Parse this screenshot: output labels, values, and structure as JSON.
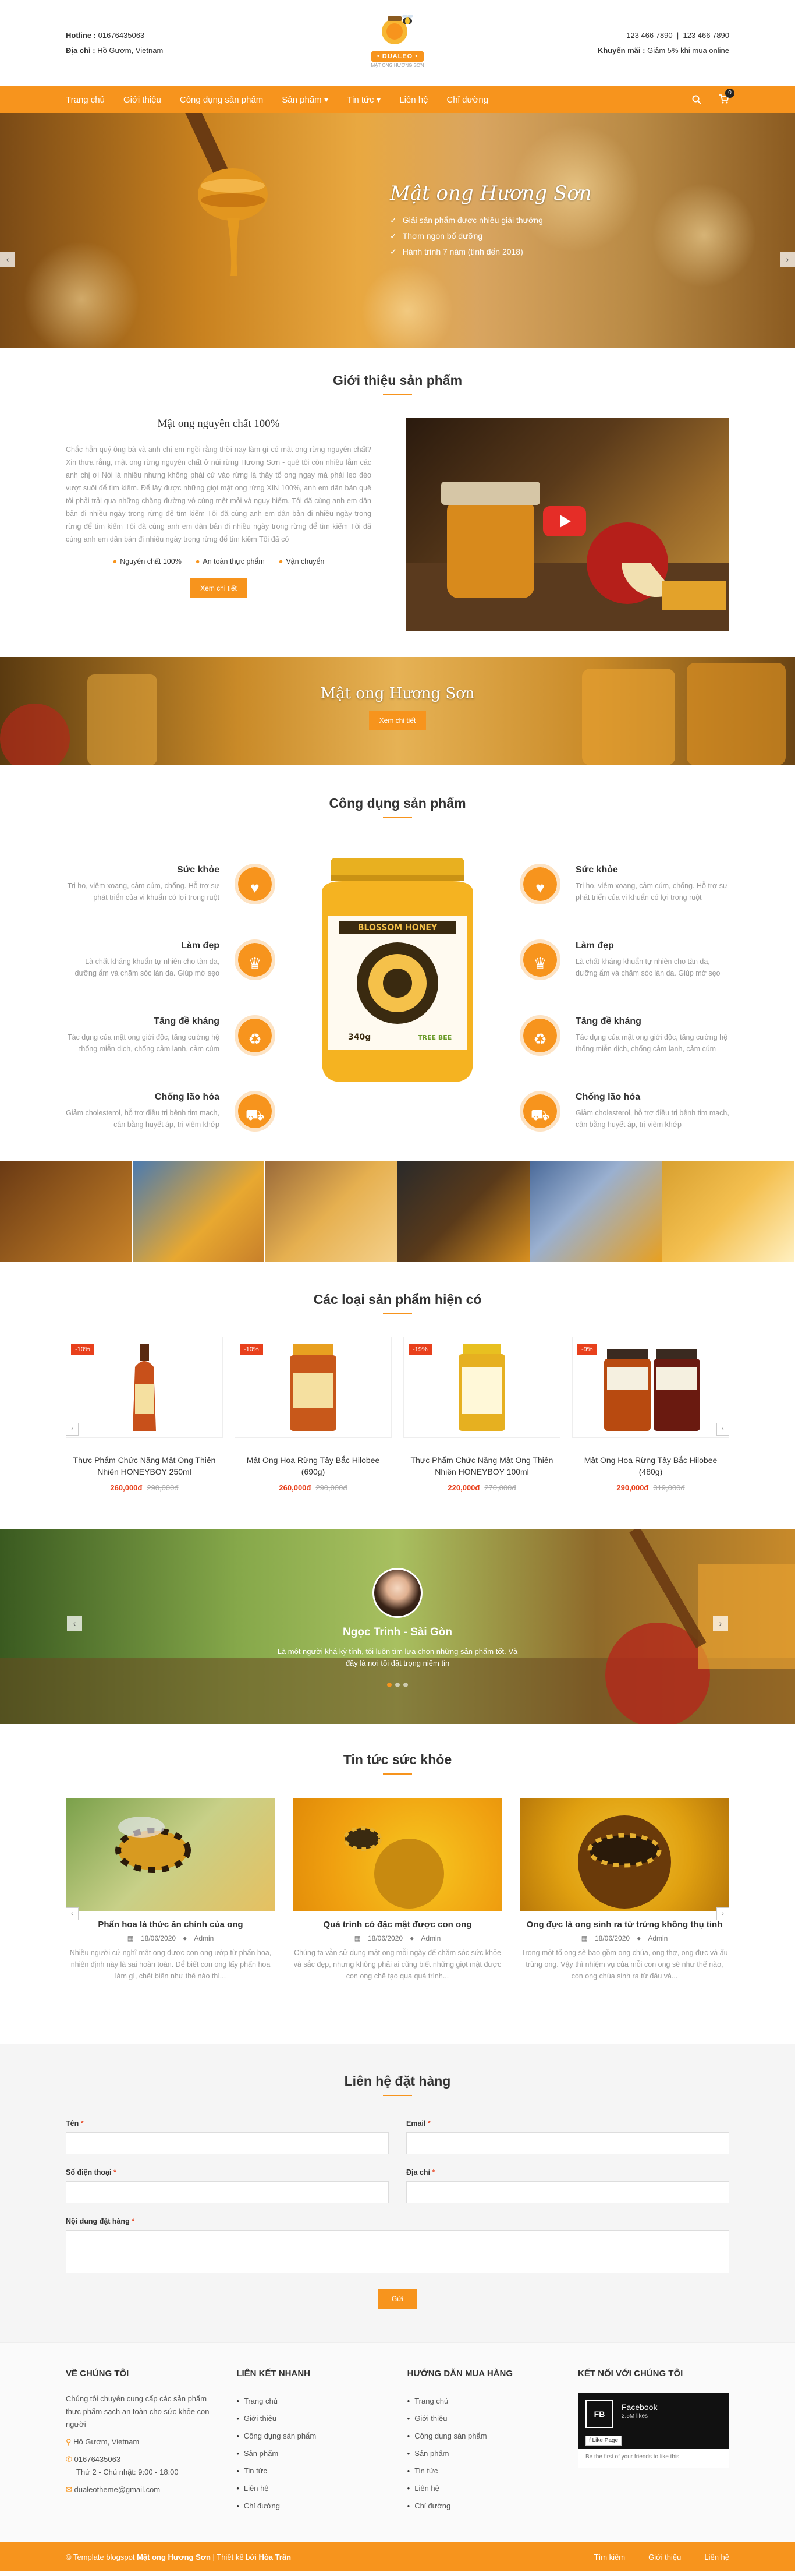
{
  "header": {
    "hotline_label": "Hotline :",
    "hotline": "01676435063",
    "address_label": "Địa chỉ :",
    "address": "Hồ Gươm, Vietnam",
    "brand": "• DUALEO •",
    "brand_sub": "MẬT ONG HƯƠNG SƠN",
    "phone_1": "123 466 7890",
    "phone_2": "123 466 7890",
    "promo_label": "Khuyến mãi :",
    "promo": "Giảm 5% khi mua online"
  },
  "nav": {
    "items": [
      "Trang chủ",
      "Giới thiệu",
      "Công dụng sản phẩm",
      "Sản phẩm ▾",
      "Tin tức ▾",
      "Liên hệ",
      "Chỉ đường"
    ],
    "cart_count": "0"
  },
  "slider": {
    "title": "Mật ong Hương Sơn",
    "points": [
      "Giải sản phẩm được nhiều giải thưởng",
      "Thơm ngon bổ dưỡng",
      "Hành trình 7 năm (tính đến 2018)"
    ]
  },
  "intro": {
    "section_title": "Giới thiệu sản phẩm",
    "heading": "Mật ong nguyên chất 100%",
    "body": "Chắc hẳn quý ông bà và anh chị em ngồi rằng thời nay làm gì có mật ong rừng nguyên chất? Xin thưa rằng, mật ong rừng nguyên chất ở núi rừng Hương Sơn - quê tôi còn nhiều lắm các anh chị ơi Nói là nhiều nhưng không phải cứ vào rừng là thấy tổ ong ngay mà phải leo đèo vượt suối để tìm kiếm. Để lấy được những giọt mật ong rừng XIN 100%, anh em dân bản quê tôi phải trải qua những chặng đường vô cùng mệt mỏi và nguy hiểm. Tôi đã cùng anh em dân bản đi nhiều ngày trong rừng để tìm kiếm Tôi đã cùng anh em dân bản đi nhiều ngày trong rừng để tìm kiếm Tôi đã cùng anh em dân bản đi nhiều ngày trong rừng để tìm kiếm Tôi đã cùng anh em dân bản đi nhiều ngày trong rừng để tìm kiếm Tôi đã có",
    "features": [
      "Nguyên chất 100%",
      "An toàn thực phẩm",
      "Vận chuyển"
    ],
    "button": "Xem chi tiết"
  },
  "banner": {
    "title": "Mật ong Hương Sơn",
    "button": "Xem chi tiết"
  },
  "benefits": {
    "section_title": "Công dụng sản phẩm",
    "left": [
      {
        "title": "Sức khỏe",
        "text": "Trị ho, viêm xoang, cảm cúm, chống. Hỗ trợ sự phát triển của vi khuẩn có lợi trong ruột",
        "icon": "heart-icon"
      },
      {
        "title": "Làm đẹp",
        "text": "Là chất kháng khuẩn tự nhiên cho tàn da, dưỡng ẩm và chăm sóc làn da. Giúp mờ sẹo",
        "icon": "beauty-icon"
      },
      {
        "title": "Tăng đề kháng",
        "text": "Tác dụng của mật ong giới độc, tăng cường hệ thống miễn dịch, chống cảm lạnh, cảm cúm",
        "icon": "recycle-icon"
      },
      {
        "title": "Chống lão hóa",
        "text": "Giảm cholesterol, hỗ trợ điều trị bệnh tim mạch, cân bằng huyết áp, trị viêm khớp",
        "icon": "truck-icon"
      }
    ],
    "right": [
      {
        "title": "Sức khỏe",
        "text": "Trị ho, viêm xoang, cảm cúm, chống. Hỗ trợ sự phát triển của vi khuẩn có lợi trong ruột",
        "icon": "heart-icon"
      },
      {
        "title": "Làm đẹp",
        "text": "Là chất kháng khuẩn tự nhiên cho tàn da, dưỡng ẩm và chăm sóc làn da. Giúp mờ sẹo",
        "icon": "beauty-icon"
      },
      {
        "title": "Tăng đề kháng",
        "text": "Tác dụng của mật ong giới độc, tăng cường hệ thống miễn dịch, chống cảm lạnh, cảm cúm",
        "icon": "recycle-icon"
      },
      {
        "title": "Chống lão hóa",
        "text": "Giảm cholesterol, hỗ trợ điều trị bệnh tim mạch, cân bằng huyết áp, trị viêm khớp",
        "icon": "truck-icon"
      }
    ],
    "jar_label": "BLOSSOM HONEY",
    "jar_weight": "340g",
    "jar_brand": "TREE BEE"
  },
  "products": {
    "section_title": "Các loại sản phẩm hiện có",
    "items": [
      {
        "badge": "-10%",
        "name": "Thực Phẩm Chức Năng Mật Ong Thiên Nhiên HONEYBOY 250ml",
        "price": "260,000đ",
        "old_price": "290,000đ"
      },
      {
        "badge": "-10%",
        "name": "Mật Ong Hoa Rừng Tây Bắc Hilobee (690g)",
        "price": "260,000đ",
        "old_price": "290,000đ"
      },
      {
        "badge": "-19%",
        "name": "Thực Phẩm Chức Năng Mật Ong Thiên Nhiên HONEYBOY 100ml",
        "price": "220,000đ",
        "old_price": "270,000đ"
      },
      {
        "badge": "-9%",
        "name": "Mật Ong Hoa Rừng Tây Bắc Hilobee (480g)",
        "price": "290,000đ",
        "old_price": "319,000đ"
      }
    ]
  },
  "testimonial": {
    "name": "Ngọc Trinh - Sài Gòn",
    "quote_1": "Là một người khá kỹ tính, tôi luôn tìm lựa chọn những sản phẩm tốt. Và",
    "quote_2": "đây là nơi tôi đặt trọng niềm tin"
  },
  "news": {
    "section_title": "Tin tức sức khỏe",
    "items": [
      {
        "title": "Phấn hoa là thức ăn chính của ong",
        "date": "18/06/2020",
        "author": "Admin",
        "excerpt": "Nhiều người cứ nghĩ mật ong được con ong ướp từ phấn hoa, nhiên định này là sai hoàn toàn. Để biết con ong lấy phấn hoa làm gì, chết biến như thế nào thì..."
      },
      {
        "title": "Quá trình có đặc mật được con ong",
        "date": "18/06/2020",
        "author": "Admin",
        "excerpt": "Chúng ta vẫn sử dụng mật ong mỗi ngày để chăm sóc sức khỏe và sắc đẹp, nhưng không phải ai cũng biết những giọt mật được con ong chế tạo qua quá trình..."
      },
      {
        "title": "Ong đực là ong sinh ra từ trứng không thụ tinh",
        "date": "18/06/2020",
        "author": "Admin",
        "excerpt": "Trong một tổ ong sẽ bao gồm ong chúa, ong thợ, ong đực và ấu trùng ong. Vậy thì nhiệm vụ của mỗi con ong sẽ như thế nào, con ong chúa sinh ra từ đâu và..."
      }
    ]
  },
  "contact": {
    "section_title": "Liên hệ đặt hàng",
    "name_label": "Tên",
    "email_label": "Email",
    "phone_label": "Số điện thoại",
    "address_label": "Địa chỉ",
    "content_label": "Nội dung đặt hàng",
    "required": "*",
    "submit": "Gửi"
  },
  "footer": {
    "about_title": "VỀ CHÚNG TÔI",
    "about_text": "Chúng tôi chuyên cung cấp các sản phẩm thực phẩm sạch an toàn cho sức khỏe con người",
    "address": "Hồ Gươm, Vietnam",
    "phone": "01676435063",
    "hours": "Thứ 2 - Chủ nhật: 9:00 - 18:00",
    "email": "dualeotheme@gmail.com",
    "links_title": "LIÊN KẾT NHANH",
    "links": [
      "Trang chủ",
      "Giới thiệu",
      "Công dụng sản phẩm",
      "Sản phẩm",
      "Tin tức",
      "Liên hệ",
      "Chỉ đường"
    ],
    "guide_title": "HƯỚNG DẪN MUA HÀNG",
    "guide": [
      "Trang chủ",
      "Giới thiệu",
      "Công dụng sản phẩm",
      "Sản phẩm",
      "Tin tức",
      "Liên hệ",
      "Chỉ đường"
    ],
    "social_title": "KẾT NỐI VỚI CHÚNG TÔI",
    "fb_name": "Facebook",
    "fb_likes": "2.5M likes",
    "fb_like": "Like Page",
    "fb_foot": "Be the first of your friends to like this",
    "copyright_prefix": "© Template blogspot",
    "copyright_brand": "Mật ong Hương Sơn",
    "copyright_mid": "| Thiết kế bởi",
    "copyright_author": "Hòa Trần",
    "bottom_links": [
      "Tìm kiếm",
      "Giới thiệu",
      "Liên hệ"
    ]
  },
  "colors": {
    "accent": "#f7941d",
    "sale": "#e8401c"
  }
}
